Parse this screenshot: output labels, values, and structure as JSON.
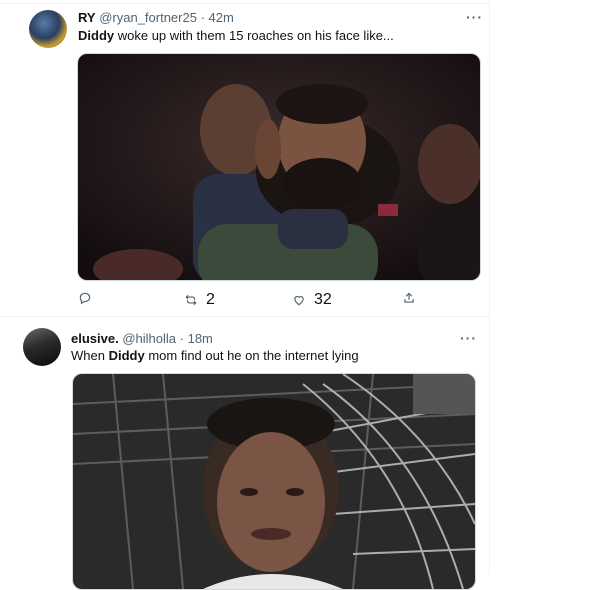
{
  "tweets": [
    {
      "name": "RY",
      "handle": "@ryan_fortner25",
      "time": "42m",
      "text_bold": "Diddy",
      "text_rest": " woke up with them 15 roaches on his face like...",
      "retweets": "2",
      "likes": "32",
      "more_icon": "more-dots-icon"
    },
    {
      "name": "elusive.",
      "handle": "@hilholla",
      "time": "18m",
      "text_pre": "When ",
      "text_bold": "Diddy",
      "text_rest": " mom find out he on the internet lying",
      "more_icon": "more-dots-icon"
    }
  ],
  "colors": {
    "text": "#0f1419",
    "muted": "#536471",
    "border": "#cfd9de"
  }
}
